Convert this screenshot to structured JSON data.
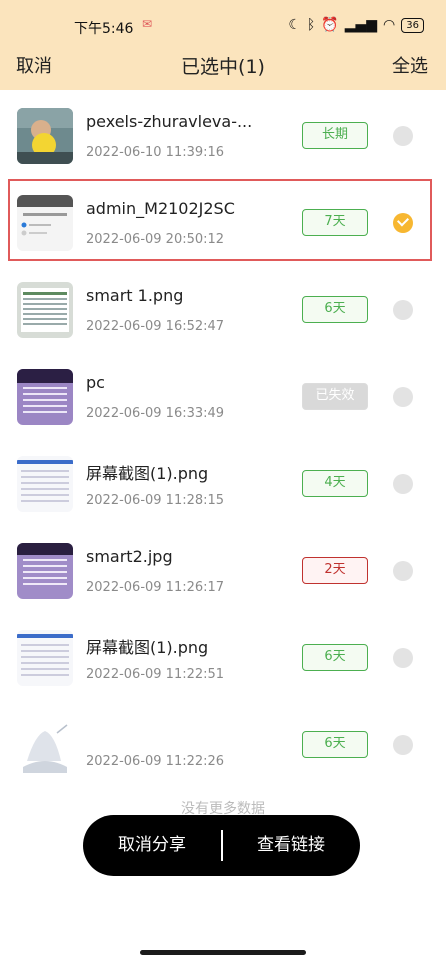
{
  "status_bar": {
    "time": "下午5:46",
    "battery": "36"
  },
  "header": {
    "cancel_label": "取消",
    "title": "已选中(1)",
    "select_all_label": "全选"
  },
  "items": [
    {
      "name": "pexels-zhuravleva-...",
      "date": "2022-06-10 11:39:16",
      "validity": "长期",
      "status": "green",
      "selected": false
    },
    {
      "name": "admin_M2102J2SC",
      "date": "2022-06-09 20:50:12",
      "validity": "7天",
      "status": "green",
      "selected": true
    },
    {
      "name": "smart 1.png",
      "date": "2022-06-09 16:52:47",
      "validity": "6天",
      "status": "green",
      "selected": false
    },
    {
      "name": "pc",
      "date": "2022-06-09 16:33:49",
      "validity": "已失效",
      "status": "expired",
      "selected": false
    },
    {
      "name": "屏幕截图(1).png",
      "date": "2022-06-09 11:28:15",
      "validity": "4天",
      "status": "green",
      "selected": false
    },
    {
      "name": "smart2.jpg",
      "date": "2022-06-09 11:26:17",
      "validity": "2天",
      "status": "red",
      "selected": false
    },
    {
      "name": "屏幕截图(1).png",
      "date": "2022-06-09 11:22:51",
      "validity": "6天",
      "status": "green",
      "selected": false
    },
    {
      "name": "",
      "date": "2022-06-09 11:22:26",
      "validity": "6天",
      "status": "green",
      "selected": false
    }
  ],
  "no_more_text": "没有更多数据",
  "actions": {
    "cancel_share_label": "取消分享",
    "view_link_label": "查看链接"
  },
  "colors": {
    "header_bg": "#fbe4bd",
    "green": "#4caf50",
    "red": "#c0322f",
    "check": "#f7b731"
  }
}
